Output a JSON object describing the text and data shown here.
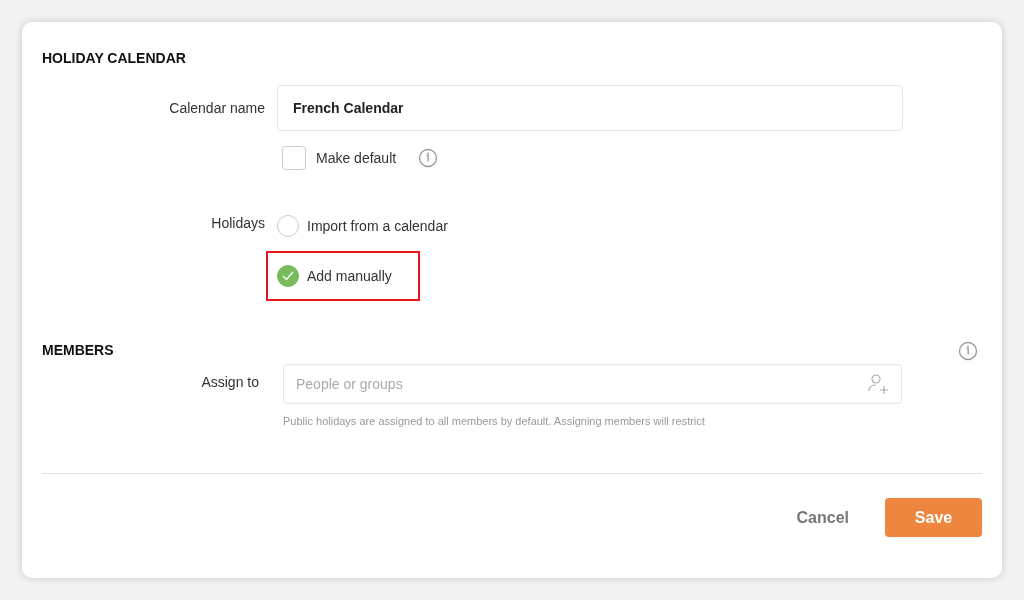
{
  "holiday_calendar": {
    "heading": "HOLIDAY CALENDAR",
    "calendar_name": {
      "label": "Calendar name",
      "value": "French Calendar"
    },
    "make_default": {
      "label": "Make default",
      "checked": false
    },
    "holidays": {
      "label": "Holidays",
      "options": [
        {
          "label": "Import from a calendar",
          "selected": false,
          "highlighted": false
        },
        {
          "label": "Add manually",
          "selected": true,
          "highlighted": true
        }
      ]
    }
  },
  "members": {
    "heading": "MEMBERS",
    "assign_to": {
      "label": "Assign to",
      "placeholder": "People or groups",
      "hint": "Public holidays are assigned to all members by default. Assigning members will restrict"
    }
  },
  "buttons": [
    {
      "kind": "secondary",
      "label": "Cancel"
    },
    {
      "kind": "primary",
      "label": "Save"
    }
  ]
}
